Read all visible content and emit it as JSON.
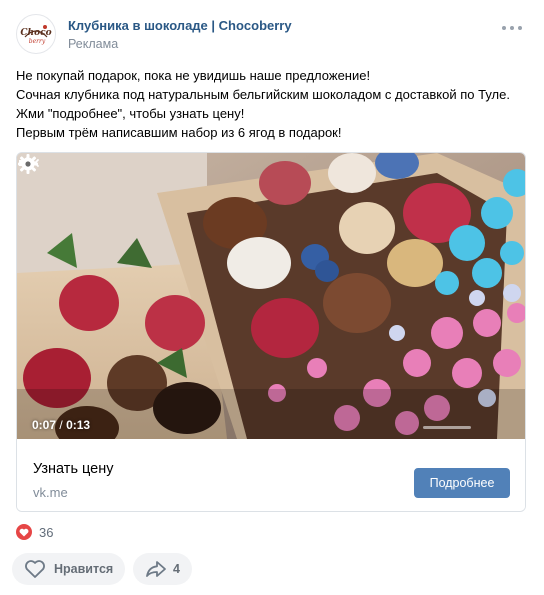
{
  "post": {
    "author": "Клубника в шоколаде | Chocoberry",
    "label": "Реклама",
    "avatar_text": "Choco berry",
    "text_lines": [
      "Не покупай подарок, пока не увидишь наше предложение!",
      "Сочная клубника под натуральным бельгийским шоколадом с доставкой по Туле.",
      "Жми \"подробнее\", чтобы узнать цену!",
      "Первым трём написавшим набор из 6 ягод в подарок!"
    ]
  },
  "video": {
    "current_time": "0:07",
    "separator": "/",
    "duration": "0:13"
  },
  "card": {
    "title": "Узнать цену",
    "domain": "vk.me",
    "cta_label": "Подробнее"
  },
  "reactions": {
    "count": "36"
  },
  "actions": {
    "like_label": "Нравится",
    "share_count": "4"
  },
  "colors": {
    "link_blue": "#2a5885",
    "button_blue": "#5181b8",
    "reaction_red": "#e64646",
    "secondary_text": "#818c99"
  }
}
